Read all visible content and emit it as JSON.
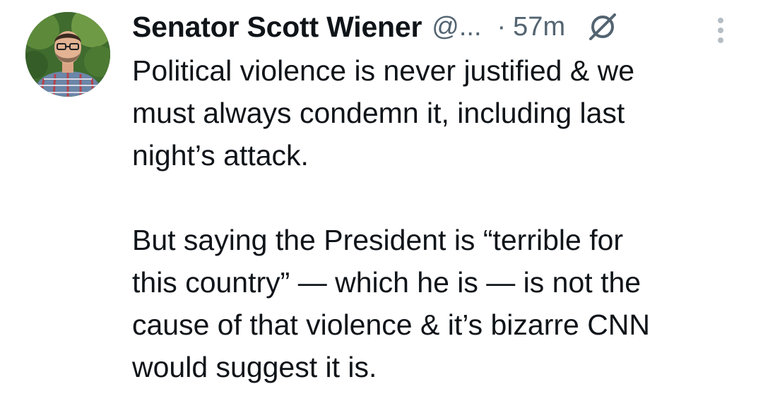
{
  "tweet": {
    "display_name": "Senator Scott Wiener",
    "handle": "@...",
    "separator": "·",
    "timestamp": "57m",
    "avatar_icon": "profile-photo",
    "status_icon": "muted-circle-slash-icon",
    "more_icon": "more-vertical-icon",
    "paragraphs": [
      "Political violence is never justified & we\nmust always condemn it, including last\nnight’s attack.",
      "But saying the President is “terrible for\nthis country” — which he is — is not the\ncause of that violence & it’s bizarre CNN\nwould suggest it is."
    ]
  },
  "colors": {
    "text_primary": "#0f1419",
    "text_secondary": "#536471"
  }
}
